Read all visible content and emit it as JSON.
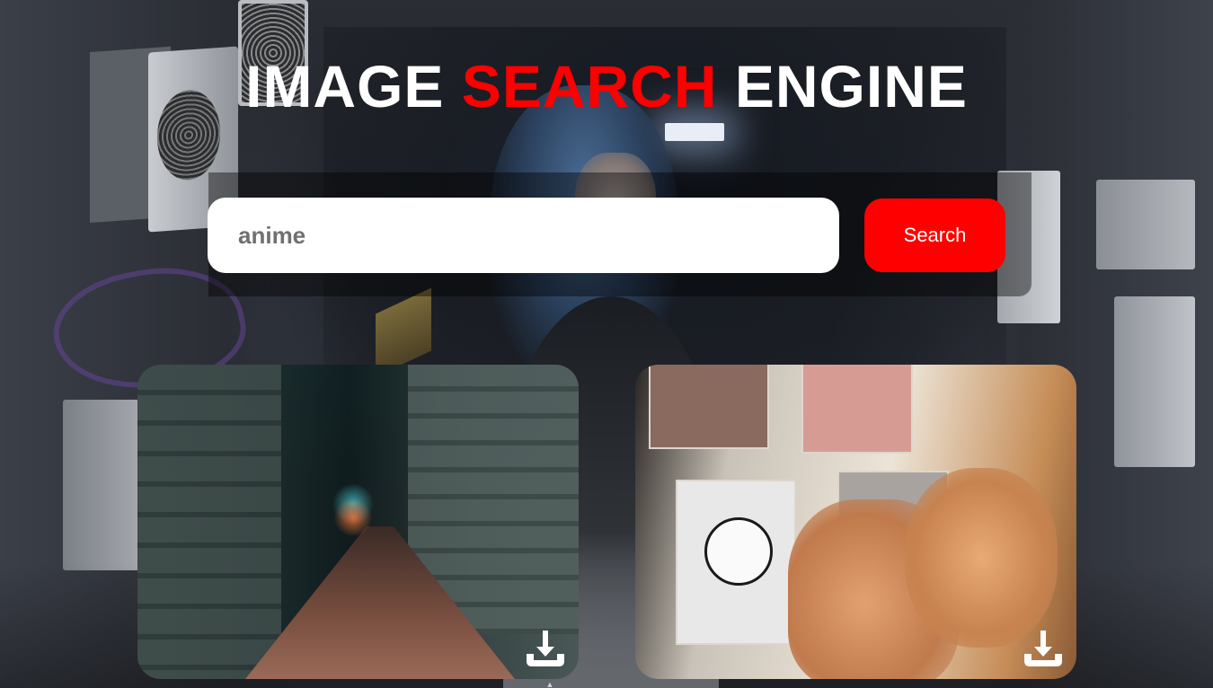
{
  "header": {
    "title_part1": "IMAGE ",
    "title_accent": "SEARCH",
    "title_part3": " ENGINE"
  },
  "search": {
    "value": "anime",
    "button_label": "Search"
  },
  "results": [
    {
      "scene": "night-street",
      "download_icon": "download-icon"
    },
    {
      "scene": "hands-pinning-anime-photos",
      "download_icon": "download-icon"
    }
  ],
  "colors": {
    "accent": "#ff0000",
    "title": "#ffffff",
    "input_background": "#ffffff",
    "input_text": "#707070",
    "button_text": "#ffffff"
  }
}
